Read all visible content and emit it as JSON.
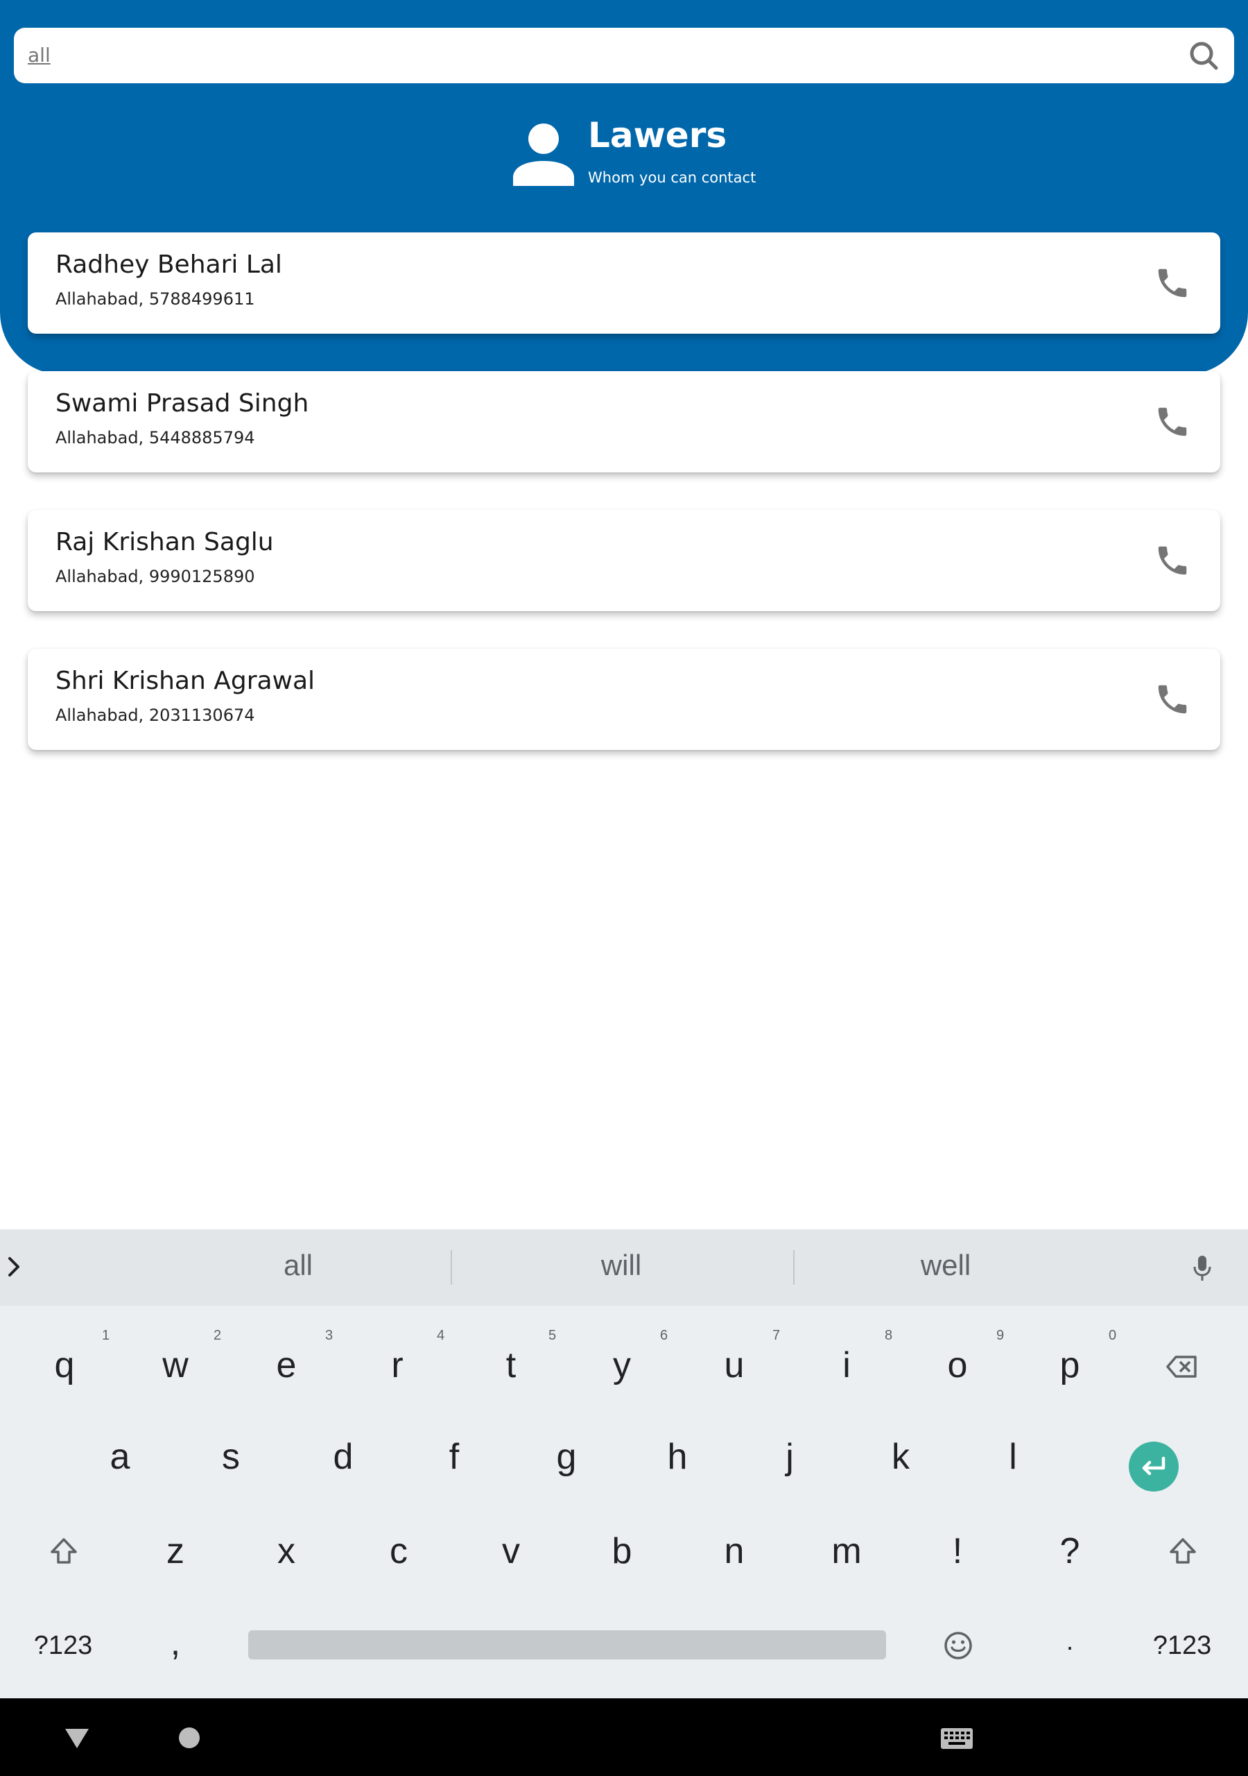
{
  "search": {
    "value": "all",
    "icon": "search-icon"
  },
  "header": {
    "title": "Lawers",
    "subtitle": "Whom you can contact",
    "icon": "person-icon"
  },
  "contacts": [
    {
      "name": "Radhey Behari Lal",
      "info": "Allahabad, 5788499611"
    },
    {
      "name": "Swami Prasad Singh",
      "info": "Allahabad, 5448885794"
    },
    {
      "name": "Raj Krishan Saglu",
      "info": "Allahabad, 9990125890"
    },
    {
      "name": "Shri Krishan Agrawal",
      "info": "Allahabad, 2031130674"
    }
  ],
  "keyboard": {
    "suggestions": [
      "all",
      "will",
      "well"
    ],
    "row1": [
      "q",
      "w",
      "e",
      "r",
      "t",
      "y",
      "u",
      "i",
      "o",
      "p"
    ],
    "row1_hints": [
      "1",
      "2",
      "3",
      "4",
      "5",
      "6",
      "7",
      "8",
      "9",
      "0"
    ],
    "row2": [
      "a",
      "s",
      "d",
      "f",
      "g",
      "h",
      "j",
      "k",
      "l"
    ],
    "row3": [
      "z",
      "x",
      "c",
      "v",
      "b",
      "n",
      "m",
      "!",
      "?"
    ],
    "symbols_label": "?123",
    "comma": ",",
    "period": "."
  },
  "colors": {
    "header_blue": "#0067AB",
    "enter_teal": "#3BB3A0",
    "keyboard_bg": "#ECEFF1"
  }
}
